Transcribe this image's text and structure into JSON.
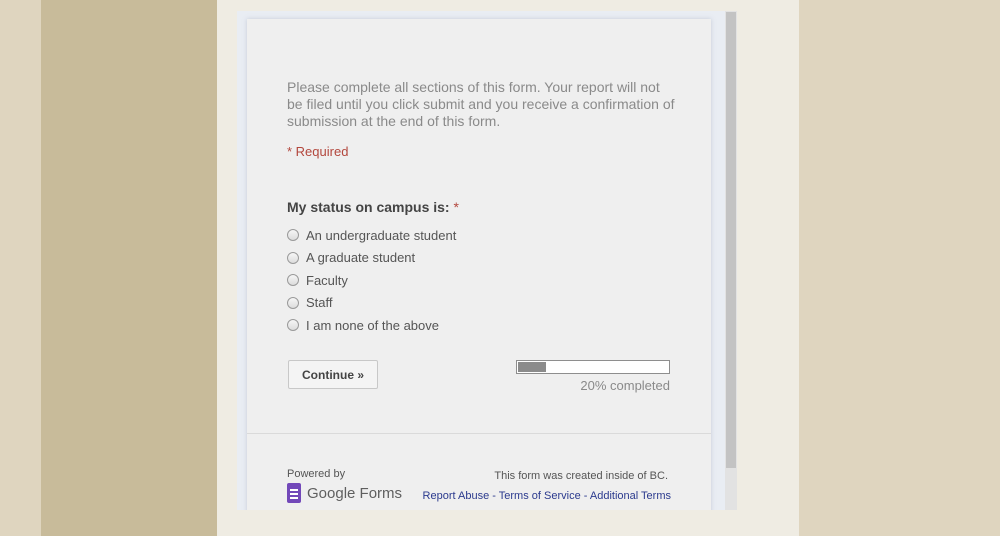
{
  "form": {
    "description": "Please complete all sections of this form. Your report will not be filed until you click submit and you receive a confirmation of submission at the end of this form.",
    "required_note": "* Required",
    "question": {
      "title": "My status on campus is:",
      "required_star": "*",
      "options": [
        {
          "label": "An undergraduate student"
        },
        {
          "label": "A graduate student"
        },
        {
          "label": "Faculty"
        },
        {
          "label": "Staff"
        },
        {
          "label": "I am none of the above"
        }
      ]
    },
    "continue_label": "Continue »",
    "progress": {
      "percent": 20,
      "text": "20% completed"
    }
  },
  "footer": {
    "powered_by": "Powered by",
    "logo_text": "Google Forms",
    "created_note": "This form was created inside of BC.",
    "links": {
      "report_abuse": "Report Abuse",
      "terms": "Terms of Service",
      "additional": "Additional Terms",
      "separator": " - "
    }
  },
  "colors": {
    "required": "#b3473d",
    "link": "#2b3a8e",
    "progress_fill": "#8b8b8b",
    "brand": "#7248b9"
  },
  "icons": {
    "logo": "google-forms-icon"
  }
}
